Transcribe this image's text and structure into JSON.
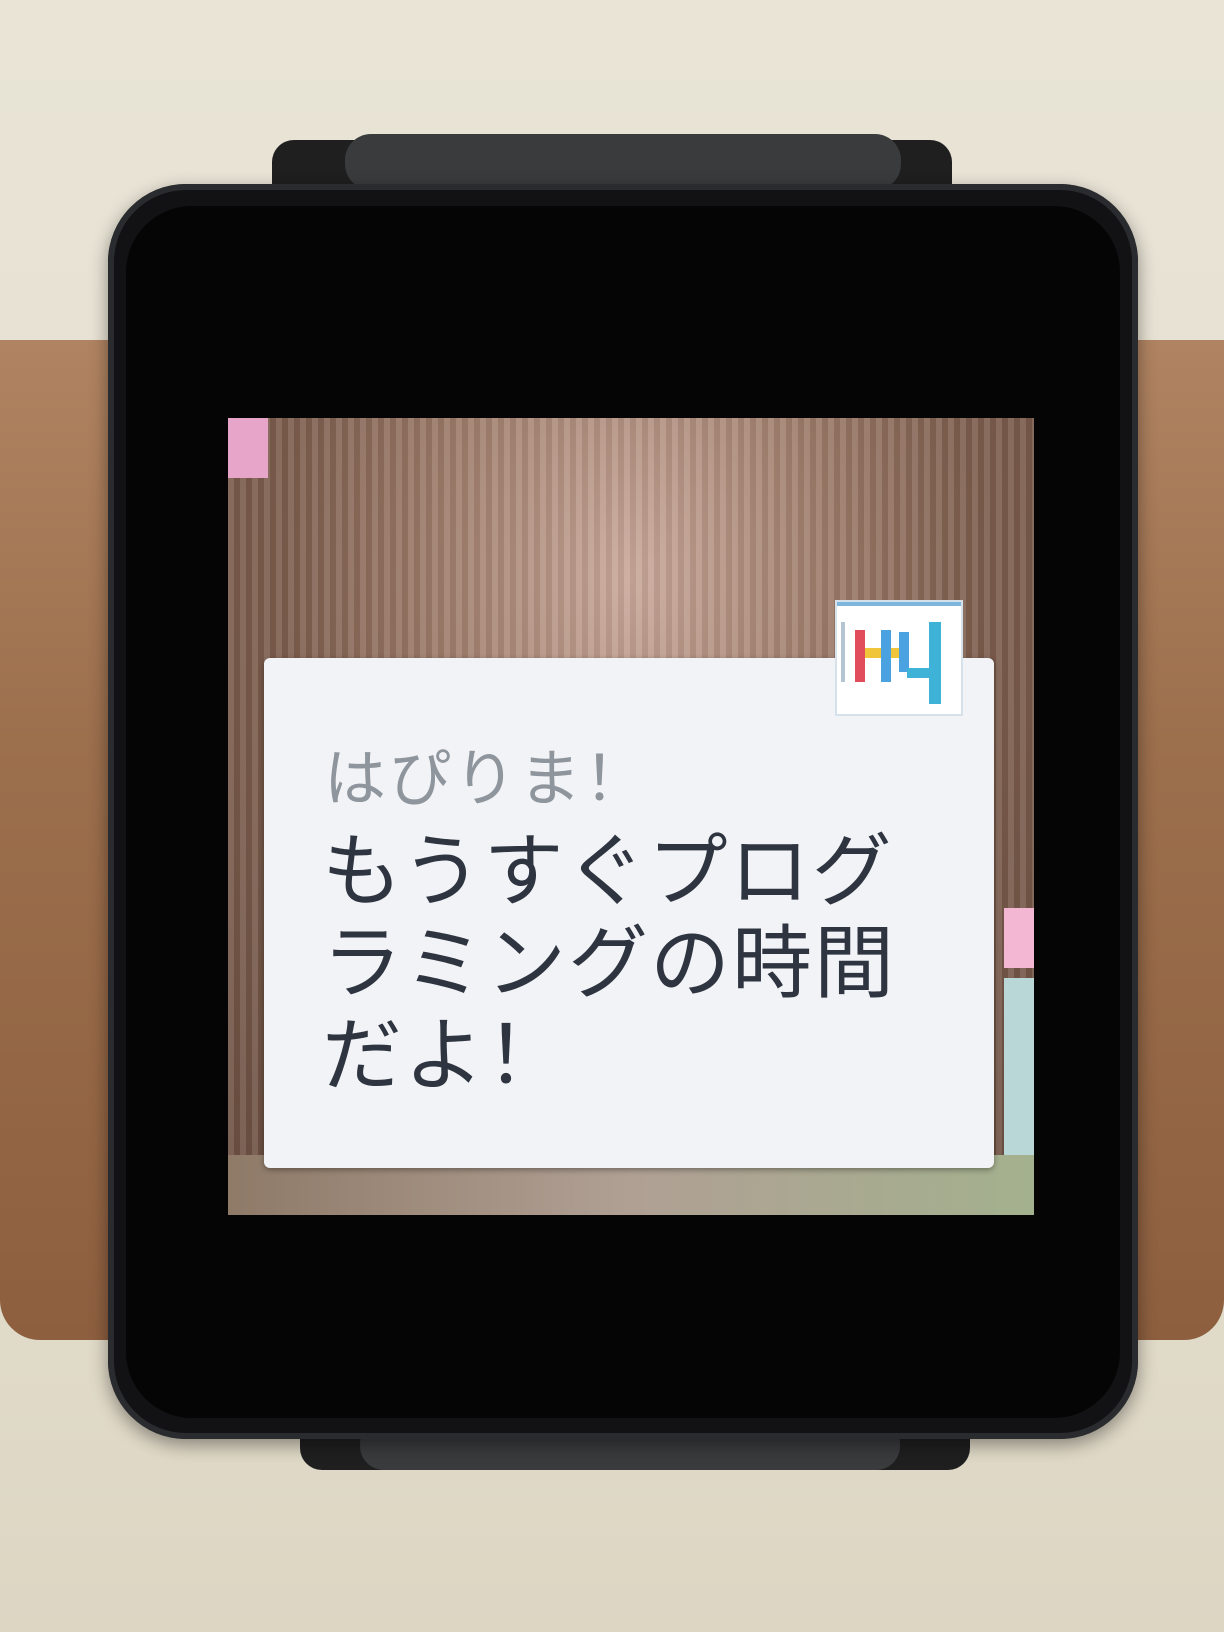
{
  "notification": {
    "title": "はぴりま！",
    "body_lines": [
      "もうすぐプログ",
      "ラミングの時間",
      "だよ！"
    ]
  },
  "colors": {
    "card_bg": "#f1f3f6",
    "title_text": "#8f959c",
    "body_text": "#2e3440",
    "watch_body": "#121214"
  },
  "icons": {
    "app_icon": "happy-learning-app-icon"
  }
}
